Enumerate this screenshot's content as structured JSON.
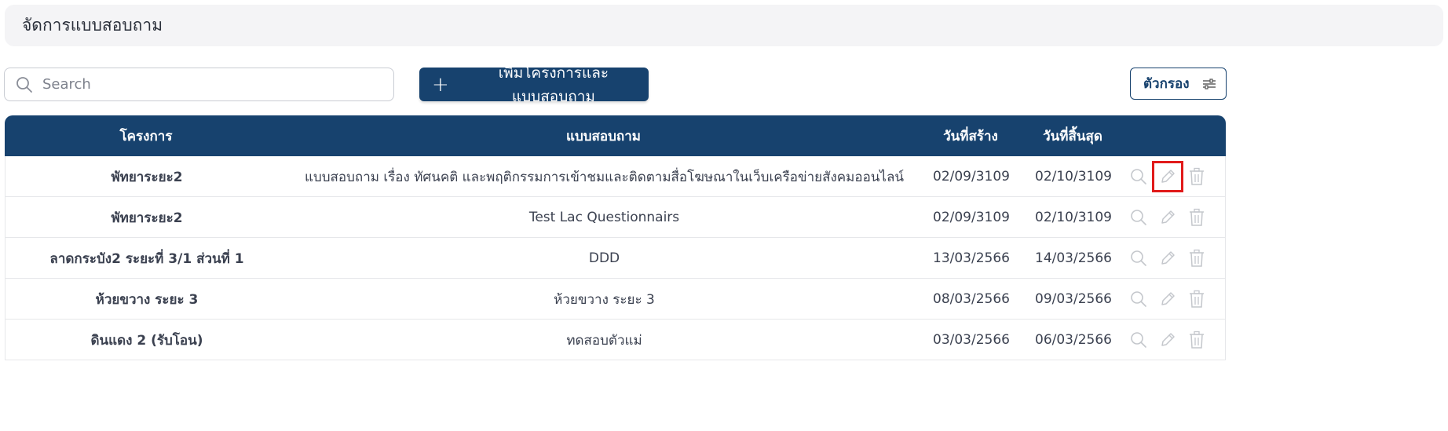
{
  "header": {
    "title": "จัดการแบบสอบถาม"
  },
  "toolbar": {
    "search_placeholder": "Search",
    "add_label": "เพิ่มโครงการและแบบสอบถาม",
    "filter_label": "ตัวกรอง"
  },
  "table": {
    "columns": {
      "project": "โครงการ",
      "questionnaire": "แบบสอบถาม",
      "created": "วันที่สร้าง",
      "end": "วันที่สิ้นสุด"
    },
    "rows": [
      {
        "project": "พัทยาระยะ2",
        "questionnaire": "แบบสอบถาม เรื่อง ทัศนคติ และพฤติกรรมการเข้าชมและติดตามสื่อโฆษณาในเว็บเครือข่ายสังคมออนไลน์",
        "created": "02/09/3109",
        "end": "02/10/3109"
      },
      {
        "project": "พัทยาระยะ2",
        "questionnaire": "Test Lac Questionnairs",
        "created": "02/09/3109",
        "end": "02/10/3109"
      },
      {
        "project": "ลาดกระบัง2 ระยะที่ 3/1 ส่วนที่ 1",
        "questionnaire": "DDD",
        "created": "13/03/2566",
        "end": "14/03/2566"
      },
      {
        "project": "ห้วยขวาง ระยะ 3",
        "questionnaire": "ห้วยขวาง ระยะ 3",
        "created": "08/03/2566",
        "end": "09/03/2566"
      },
      {
        "project": "ดินแดง 2 (รับโอน)",
        "questionnaire": "ทดสอบตัวแม่",
        "created": "03/03/2566",
        "end": "06/03/2566"
      }
    ]
  },
  "colors": {
    "primary": "#17426e",
    "highlight": "#e11a1a",
    "icon": "#c4c7cc"
  }
}
